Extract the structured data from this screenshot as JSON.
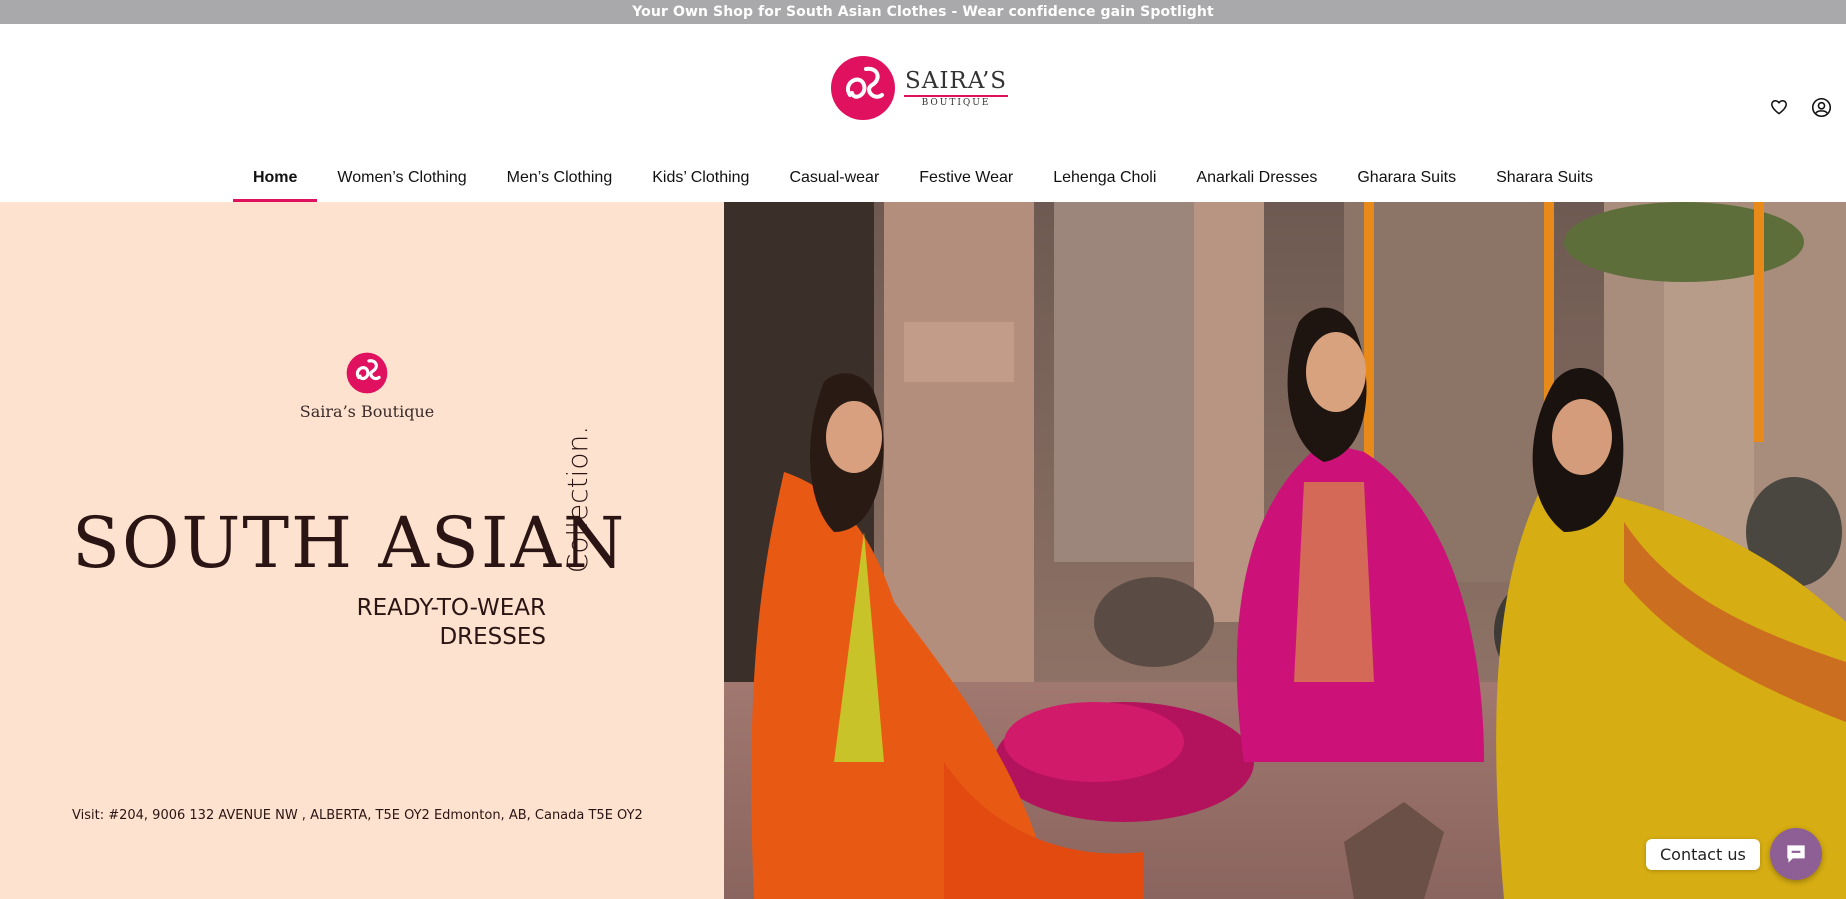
{
  "announcement": {
    "text": "Your Own Shop for South Asian Clothes - Wear confidence gain Spotlight"
  },
  "header": {
    "logo": {
      "name": "SAIRA’S",
      "sub": "BOUTIQUE"
    },
    "icons": [
      "heart-icon",
      "user-icon"
    ]
  },
  "nav": {
    "items": [
      {
        "label": "Home",
        "active": true
      },
      {
        "label": "Women’s Clothing"
      },
      {
        "label": "Men’s Clothing"
      },
      {
        "label": "Kids’ Clothing"
      },
      {
        "label": "Casual-wear"
      },
      {
        "label": "Festive Wear"
      },
      {
        "label": "Lehenga Choli"
      },
      {
        "label": "Anarkali Dresses"
      },
      {
        "label": "Gharara Suits"
      },
      {
        "label": "Sharara Suits"
      }
    ]
  },
  "hero": {
    "brand": "Saira’s Boutique",
    "headline": "SOUTH ASIAN",
    "collection": "Collection.",
    "subhead_line1": "READY-TO-WEAR",
    "subhead_line2": "DRESSES",
    "address": "Visit: #204, 9006 132 AVENUE NW , ALBERTA, T5E OY2 Edmonton, AB, Canada T5E OY2"
  },
  "contact": {
    "label": "Contact us"
  },
  "colors": {
    "accent": "#e0115f",
    "announcement_bg": "#a9a8aa",
    "hero_left_bg": "#fde3cf",
    "contact_fab": "#8e5f95"
  }
}
